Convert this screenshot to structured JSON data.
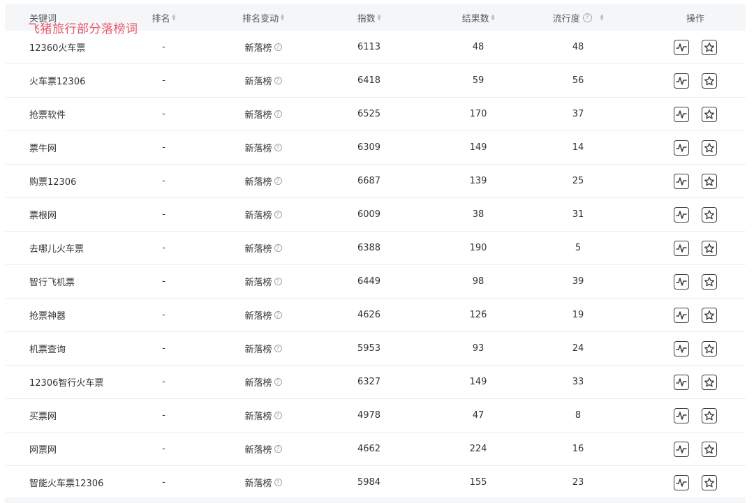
{
  "overlay_title": "飞猪旅行部分落榜词",
  "columns": {
    "keyword": "关键词",
    "rank": "排名",
    "rank_change": "排名变动",
    "index": "指数",
    "results": "结果数",
    "popularity": "流行度",
    "popularity_help": "?",
    "action": "操作"
  },
  "rows": [
    {
      "keyword": "12360火车票",
      "rank": "-",
      "change": "新落榜",
      "index": "6113",
      "results": "48",
      "popularity": "48"
    },
    {
      "keyword": "火车票12306",
      "rank": "-",
      "change": "新落榜",
      "index": "6418",
      "results": "59",
      "popularity": "56"
    },
    {
      "keyword": "抢票软件",
      "rank": "-",
      "change": "新落榜",
      "index": "6525",
      "results": "170",
      "popularity": "37"
    },
    {
      "keyword": "票牛网",
      "rank": "-",
      "change": "新落榜",
      "index": "6309",
      "results": "149",
      "popularity": "14"
    },
    {
      "keyword": "购票12306",
      "rank": "-",
      "change": "新落榜",
      "index": "6687",
      "results": "139",
      "popularity": "25"
    },
    {
      "keyword": "票根网",
      "rank": "-",
      "change": "新落榜",
      "index": "6009",
      "results": "38",
      "popularity": "31"
    },
    {
      "keyword": "去哪儿火车票",
      "rank": "-",
      "change": "新落榜",
      "index": "6388",
      "results": "190",
      "popularity": "5"
    },
    {
      "keyword": "智行飞机票",
      "rank": "-",
      "change": "新落榜",
      "index": "6449",
      "results": "98",
      "popularity": "39"
    },
    {
      "keyword": "抢票神器",
      "rank": "-",
      "change": "新落榜",
      "index": "4626",
      "results": "126",
      "popularity": "19"
    },
    {
      "keyword": "机票查询",
      "rank": "-",
      "change": "新落榜",
      "index": "5953",
      "results": "93",
      "popularity": "24"
    },
    {
      "keyword": "12306智行火车票",
      "rank": "-",
      "change": "新落榜",
      "index": "6327",
      "results": "149",
      "popularity": "33"
    },
    {
      "keyword": "买票网",
      "rank": "-",
      "change": "新落榜",
      "index": "4978",
      "results": "47",
      "popularity": "8"
    },
    {
      "keyword": "网票网",
      "rank": "-",
      "change": "新落榜",
      "index": "4662",
      "results": "224",
      "popularity": "16"
    },
    {
      "keyword": "智能火车票12306",
      "rank": "-",
      "change": "新落榜",
      "index": "5984",
      "results": "155",
      "popularity": "23"
    }
  ],
  "row_help": "?",
  "icons": {
    "sort": "sort-arrows-icon",
    "trend": "trend-chart-icon",
    "favorite": "star-icon"
  }
}
